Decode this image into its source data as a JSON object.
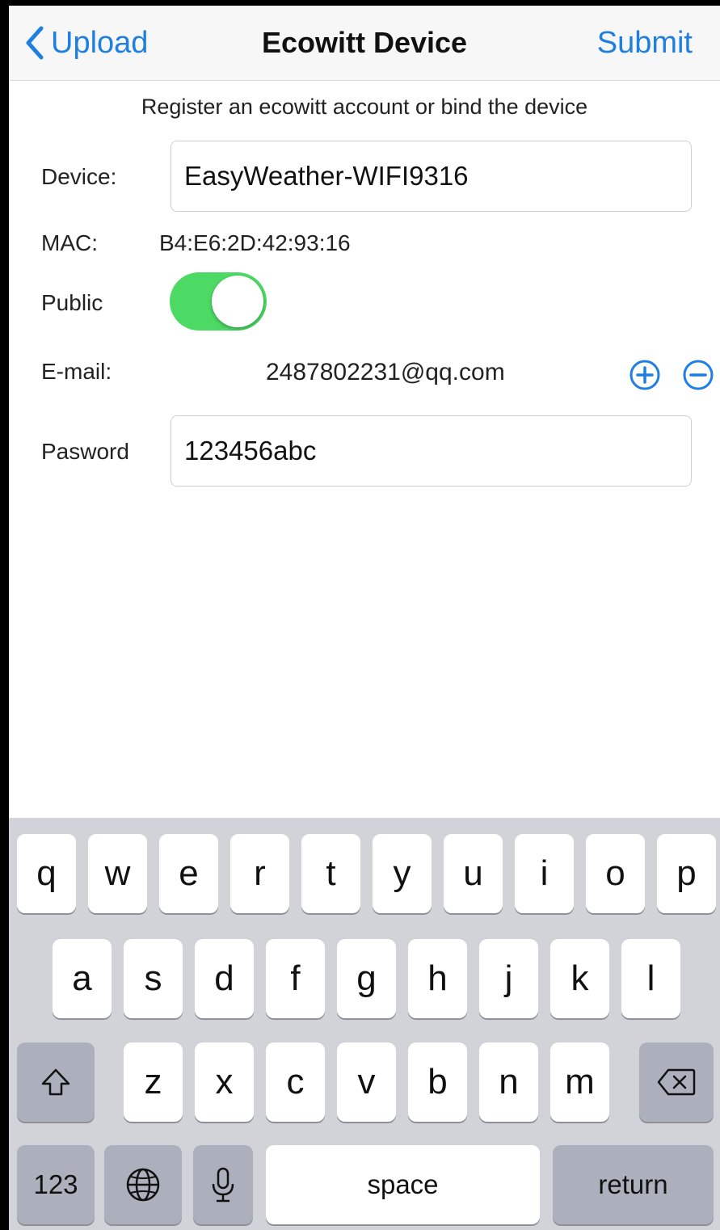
{
  "nav": {
    "back_label": "Upload",
    "title": "Ecowitt Device",
    "submit_label": "Submit"
  },
  "form": {
    "subtitle": "Register an ecowitt account or bind the device",
    "device_label": "Device:",
    "device_value": "EasyWeather-WIFI9316",
    "mac_label": "MAC:",
    "mac_value": "B4:E6:2D:42:93:16",
    "public_label": "Public",
    "public_on": true,
    "email_label": "E-mail:",
    "email_value": "2487802231@qq.com",
    "password_label": "Pasword",
    "password_value": "123456abc"
  },
  "keyboard": {
    "row1": [
      "q",
      "w",
      "e",
      "r",
      "t",
      "y",
      "u",
      "i",
      "o",
      "p"
    ],
    "row2": [
      "a",
      "s",
      "d",
      "f",
      "g",
      "h",
      "j",
      "k",
      "l"
    ],
    "row3": [
      "z",
      "x",
      "c",
      "v",
      "b",
      "n",
      "m"
    ],
    "numbers_label": "123",
    "space_label": "space",
    "return_label": "return"
  },
  "icons": {
    "back": "chevron-left-icon",
    "add": "plus-circle-icon",
    "remove": "minus-circle-icon",
    "shift": "shift-arrow-icon",
    "delete": "backspace-icon",
    "globe": "globe-icon",
    "mic": "microphone-icon"
  },
  "colors": {
    "accent": "#1f7fe0",
    "toggle_on": "#4cd964",
    "keyboard_bg": "#d1d3d9",
    "key_dark": "#abb0bc"
  }
}
